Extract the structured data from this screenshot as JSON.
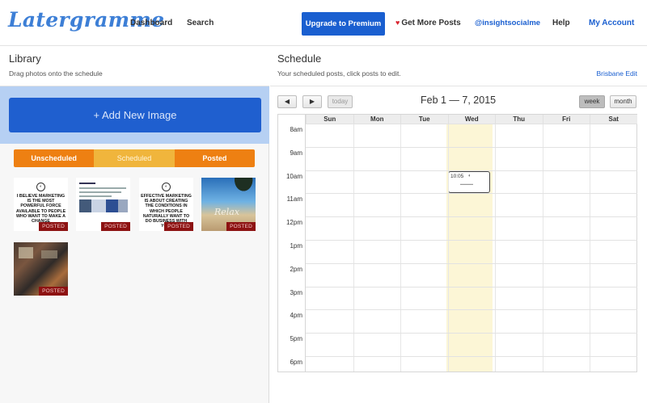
{
  "nav": {
    "logo": "Latergramme",
    "dashboard": "Dashboard",
    "search": "Search",
    "premium": "Upgrade to Premium",
    "more_posts": "Get More Posts",
    "instagram_account": "@insightsocialme",
    "help": "Help",
    "my_account": "My Account",
    "accent_color": "#1a5fd0",
    "heart_color": "#d9232e"
  },
  "library": {
    "title": "Library",
    "subtitle": "Drag photos onto the schedule",
    "add_button": "+ Add New Image",
    "filters": [
      "Unscheduled",
      "Scheduled",
      "Posted"
    ],
    "active_filter": "Posted",
    "thumbnails": [
      {
        "kind": "quote",
        "text": "I BELIEVE MARKETING IS THE MOST POWERFUL FORCE AVAILABLE TO PEOPLE WHO WANT TO MAKE A CHANGE",
        "badge": "POSTED"
      },
      {
        "kind": "tweet",
        "badge": "POSTED"
      },
      {
        "kind": "quote",
        "text": "EFFECTIVE MARKETING IS ABOUT CREATING THE CONDITIONS IN WHICH PEOPLE NATURALLY WANT TO DO BUSINESS WITH YOU.",
        "badge": "POSTED"
      },
      {
        "kind": "photo",
        "overlay": "Relax",
        "badge": "POSTED"
      },
      {
        "kind": "photo",
        "badge": "POSTED"
      }
    ]
  },
  "schedule": {
    "title": "Schedule",
    "subtitle": "Your scheduled posts, click posts to edit.",
    "timezone_link": "Brisbane Edit",
    "prev_icon": "chevron-left-icon",
    "next_icon": "chevron-right-icon",
    "today": "today",
    "range": "Feb 1 — 7, 2015",
    "view_week": "week",
    "view_month": "month",
    "active_view": "week",
    "days": [
      "Sun",
      "Mon",
      "Tue",
      "Wed",
      "Thu",
      "Fri",
      "Sat"
    ],
    "highlight_day": "Wed",
    "hours": [
      "8am",
      "9am",
      "10am",
      "11am",
      "12pm",
      "1pm",
      "2pm",
      "3pm",
      "4pm",
      "5pm",
      "6pm"
    ],
    "event": {
      "time": "10:05",
      "day": "Wed"
    }
  }
}
